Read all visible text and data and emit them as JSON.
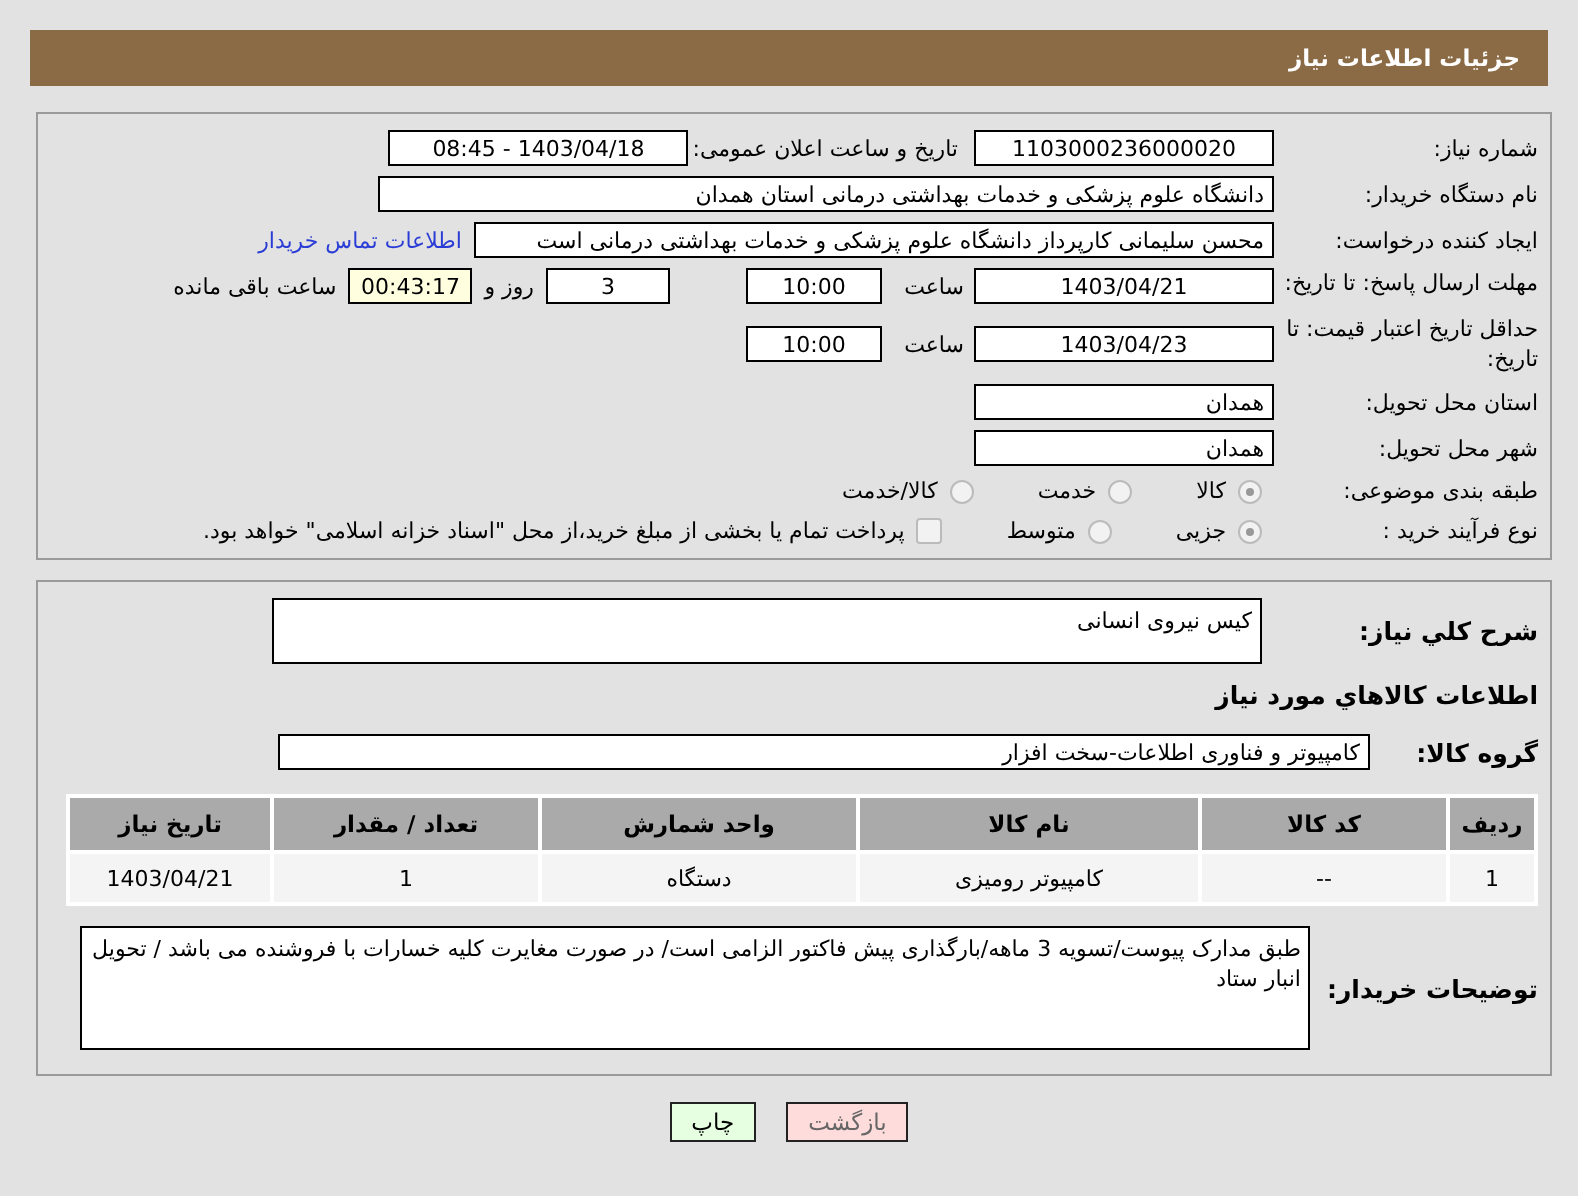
{
  "header": {
    "title": "جزئیات اطلاعات نیاز"
  },
  "need_number": {
    "label": "شماره نیاز:",
    "value": "1103000236000020"
  },
  "announce": {
    "label": "تاریخ و ساعت اعلان عمومی:",
    "value": "1403/04/18 - 08:45"
  },
  "buyer": {
    "label": "نام دستگاه خریدار:",
    "value": "دانشگاه علوم پزشکی و خدمات بهداشتی درمانی استان همدان"
  },
  "requester": {
    "label": "ایجاد کننده درخواست:",
    "value": "محسن سلیمانی کارپرداز دانشگاه علوم پزشکی و خدمات بهداشتی درمانی است",
    "link": "اطلاعات تماس خریدار"
  },
  "deadline": {
    "label": "مهلت ارسال پاسخ: تا تاریخ:",
    "date": "1403/04/21",
    "time_label": "ساعت",
    "time": "10:00",
    "days": "3",
    "days_label": "روز و",
    "remaining": "00:43:17",
    "remaining_label": "ساعت باقی مانده"
  },
  "validity": {
    "label": "حداقل تاریخ اعتبار قیمت: تا تاریخ:",
    "date": "1403/04/23",
    "time_label": "ساعت",
    "time": "10:00"
  },
  "province": {
    "label": "استان محل تحویل:",
    "value": "همدان"
  },
  "city": {
    "label": "شهر محل تحویل:",
    "value": "همدان"
  },
  "category": {
    "label": "طبقه بندی موضوعی:",
    "options": [
      {
        "label": "کالا",
        "selected": true
      },
      {
        "label": "خدمت",
        "selected": false
      },
      {
        "label": "کالا/خدمت",
        "selected": false
      }
    ]
  },
  "process": {
    "label": "نوع فرآیند خرید :",
    "options": [
      {
        "label": "جزیی",
        "selected": true
      },
      {
        "label": "متوسط",
        "selected": false
      }
    ],
    "checkbox": {
      "label": "پرداخت تمام یا بخشی از مبلغ خرید،از محل \"اسناد خزانه اسلامی\" خواهد بود.",
      "checked": false
    }
  },
  "description": {
    "label": "شرح كلي نياز:",
    "value": "کیس نیروی انسانی"
  },
  "items_title": "اطلاعات كالاهاي مورد نياز",
  "goods_group": {
    "label": "گروه کالا:",
    "value": "کامپیوتر و فناوری اطلاعات-سخت افزار"
  },
  "table": {
    "columns": [
      "ردیف",
      "کد کالا",
      "نام کالا",
      "واحد شمارش",
      "تعداد / مقدار",
      "تاریخ نیاز"
    ],
    "rows": [
      [
        "1",
        "--",
        "کامپیوتر رومیزی",
        "دستگاه",
        "1",
        "1403/04/21"
      ]
    ]
  },
  "notes": {
    "label": "توضیحات خریدار:",
    "value": "طبق مدارک پیوست/تسویه 3 ماهه/بارگذاری پیش فاکتور الزامی است/ در صورت مغایرت کلیه خسارات با فروشنده می باشد / تحویل انبار ستاد"
  },
  "buttons": [
    {
      "label": "بازگشت",
      "kind": "back"
    },
    {
      "label": "چاپ",
      "kind": "print"
    }
  ]
}
